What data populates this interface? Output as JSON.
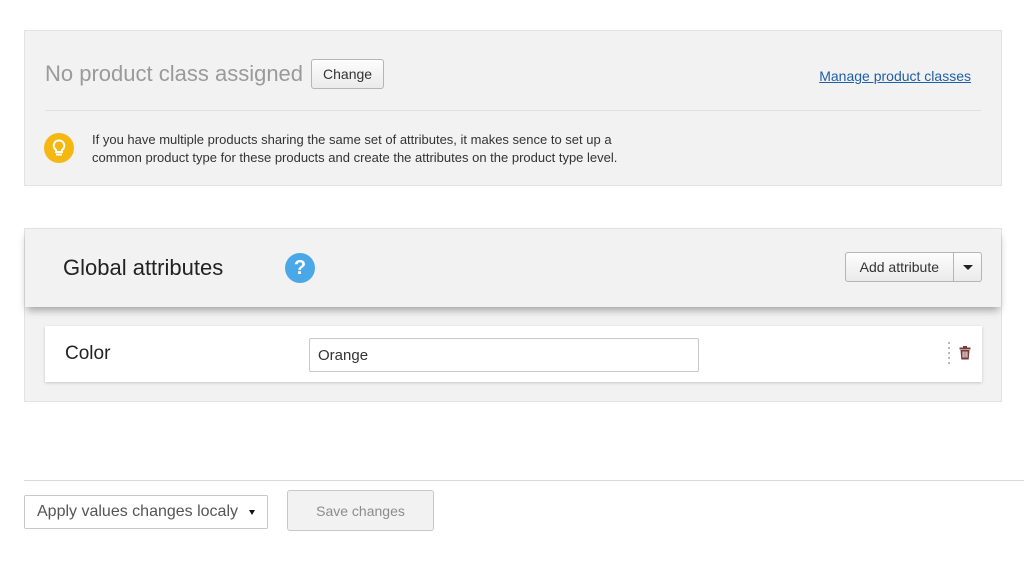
{
  "product_class": {
    "title": "No product class assigned",
    "change_label": "Change",
    "manage_link": "Manage product classes",
    "hint_icon": "lightbulb-icon",
    "hint_line1": "If you have multiple products sharing the same set of attributes, it makes sence to set up a",
    "hint_line2": "common product type for these products and create the attributes on the product type level.",
    "hint_color": "#f5b813"
  },
  "global_attributes": {
    "title": "Global attributes",
    "help_icon_text": "?",
    "help_color": "#4aa8e8",
    "add_label": "Add attribute",
    "rows": [
      {
        "name": "Color",
        "value": "Orange"
      }
    ]
  },
  "footer": {
    "scope_selected": "Apply values changes localy",
    "save_label": "Save changes"
  },
  "colors": {
    "panel_bg": "#f2f2f2",
    "link": "#1f5fa8",
    "delete": "#7a3b3b"
  }
}
